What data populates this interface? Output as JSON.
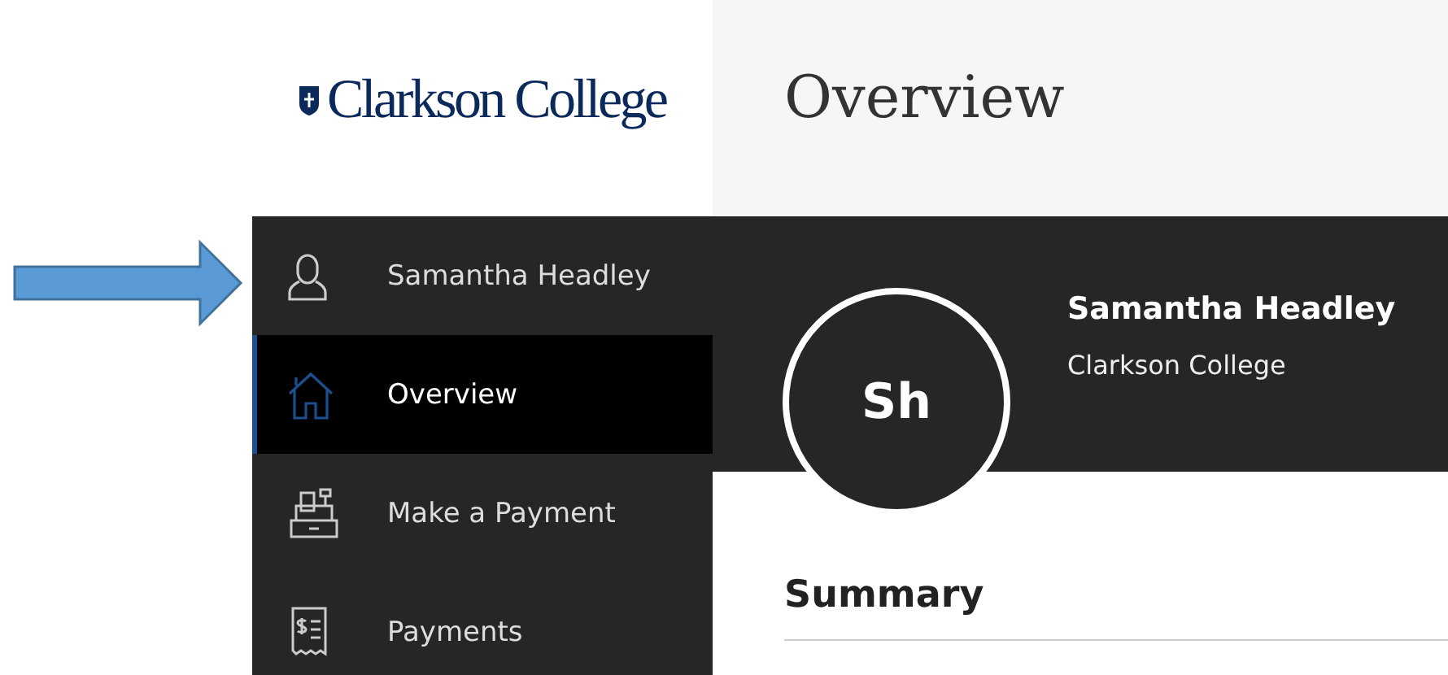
{
  "logo": {
    "text": "Clarkson College"
  },
  "header": {
    "title": "Overview"
  },
  "sidebar": {
    "items": [
      {
        "kind": "user",
        "label": "Samantha Headley",
        "selected": false
      },
      {
        "kind": "home",
        "label": "Overview",
        "selected": true
      },
      {
        "kind": "register",
        "label": "Make a Payment",
        "selected": false
      },
      {
        "kind": "receipt",
        "label": "Payments",
        "selected": false
      }
    ]
  },
  "profile": {
    "initials": "Sh",
    "name": "Samantha Headley",
    "organization": "Clarkson College"
  },
  "summary": {
    "title": "Summary"
  }
}
